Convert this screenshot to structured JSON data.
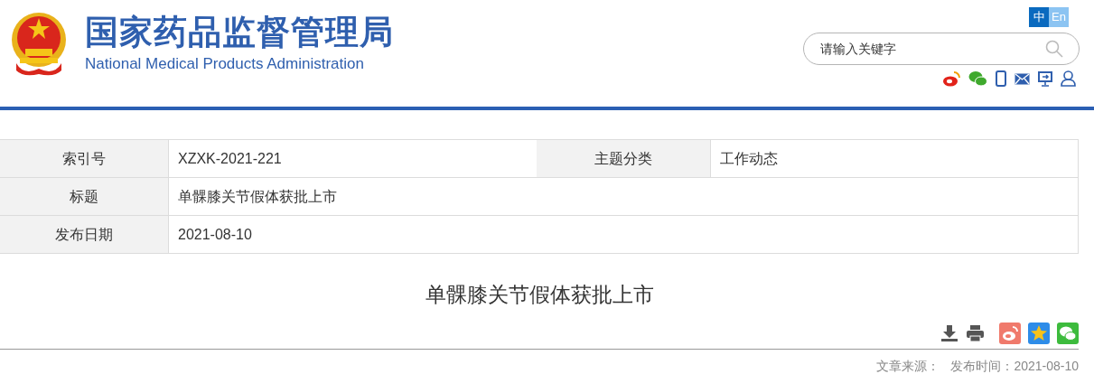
{
  "header": {
    "title": "国家药品监督管理局",
    "subtitle": "National Medical Products Administration"
  },
  "languages": [
    {
      "label": "中",
      "selected": true
    },
    {
      "label": "En",
      "selected": false
    }
  ],
  "search": {
    "placeholder": "请输入关键字"
  },
  "info_table": {
    "rows": [
      {
        "cells": [
          {
            "label": "索引号",
            "value": "XZXK-2021-221"
          },
          {
            "label": "主题分类",
            "value": "工作动态"
          }
        ]
      },
      {
        "cells": [
          {
            "label": "标题",
            "value": "单髁膝关节假体获批上市"
          }
        ]
      },
      {
        "cells": [
          {
            "label": "发布日期",
            "value": "2021-08-10"
          }
        ]
      }
    ]
  },
  "article": {
    "title": "单髁膝关节假体获批上市",
    "source_label": "文章来源：",
    "date_label": "发布时间：2021-08-10"
  }
}
